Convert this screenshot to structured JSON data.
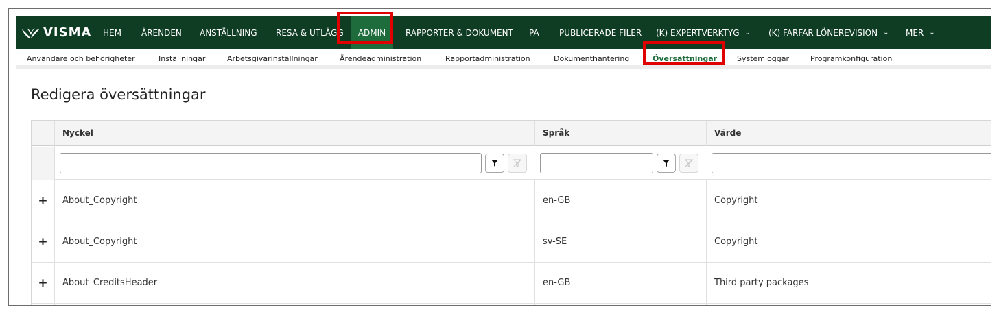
{
  "brand": {
    "name": "VISMA"
  },
  "colors": {
    "nav_bg": "#0f3d24",
    "nav_active": "#1e6b3c",
    "highlight": "#e10000",
    "active_sub": "#1e6b3c"
  },
  "topnav": {
    "items": [
      {
        "label": "HEM"
      },
      {
        "label": "ÄRENDEN"
      },
      {
        "label": "ANSTÄLLNING"
      },
      {
        "label": "RESA & UTLÄGG"
      },
      {
        "label": "ADMIN",
        "active": true
      },
      {
        "label": "RAPPORTER & DOKUMENT"
      },
      {
        "label": "PA"
      },
      {
        "label": "PUBLICERADE FILER"
      },
      {
        "label": "(K) EXPERTVERKTYG"
      },
      {
        "label": "(K) FARFAR LÖNEREVISION"
      },
      {
        "label": "MER"
      }
    ]
  },
  "subnav": {
    "items": [
      {
        "label": "Användare och behörigheter"
      },
      {
        "label": "Inställningar"
      },
      {
        "label": "Arbetsgivarinställningar"
      },
      {
        "label": "Ärendeadministration"
      },
      {
        "label": "Rapportadministration"
      },
      {
        "label": "Dokumenthantering"
      },
      {
        "label": "Översättningar",
        "active": true
      },
      {
        "label": "Systemloggar"
      },
      {
        "label": "Programkonfiguration"
      }
    ]
  },
  "page": {
    "title": "Redigera översättningar"
  },
  "grid": {
    "columns": [
      {
        "label": "Nyckel"
      },
      {
        "label": "Språk"
      },
      {
        "label": "Värde"
      }
    ],
    "filters": {
      "nyckel": "",
      "sprak": "",
      "varde": ""
    },
    "rows": [
      {
        "nyckel": "About_Copyright",
        "sprak": "en-GB",
        "varde": "Copyright"
      },
      {
        "nyckel": "About_Copyright",
        "sprak": "sv-SE",
        "varde": "Copyright"
      },
      {
        "nyckel": "About_CreditsHeader",
        "sprak": "en-GB",
        "varde": "Third party packages"
      }
    ],
    "expand_symbol": "+"
  },
  "icons": {
    "filter": "filter-icon",
    "clear_filter": "clear-filter-icon",
    "chevron": "chevron-down-icon",
    "expand": "plus-icon"
  }
}
